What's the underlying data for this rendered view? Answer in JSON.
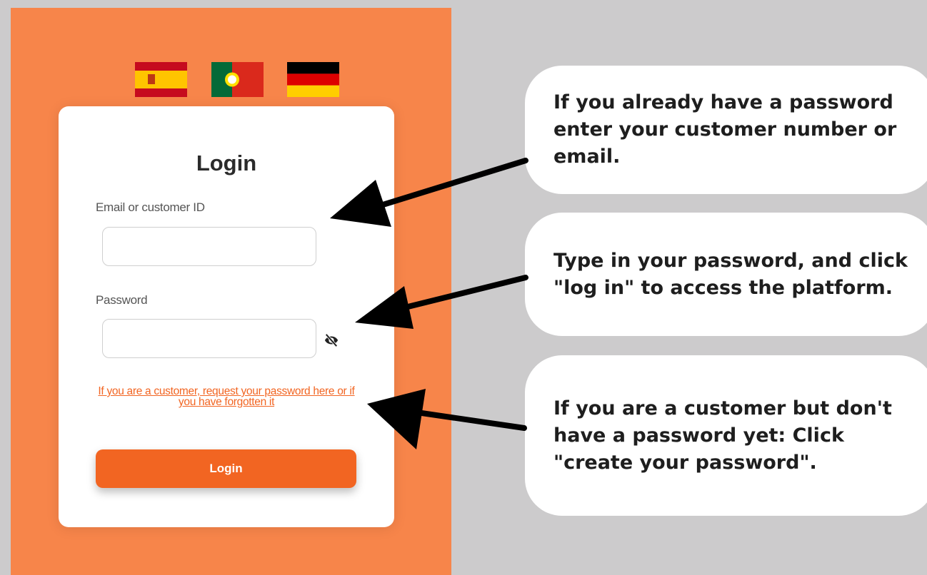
{
  "login": {
    "title": "Login",
    "email_label": "Email or customer ID",
    "email_value": "",
    "password_label": "Password",
    "password_value": "",
    "forgot_link": "If you are a customer, request your password here or if you have forgotten it",
    "login_button": "Login"
  },
  "flags": [
    {
      "name": "spain-flag"
    },
    {
      "name": "portugal-flag"
    },
    {
      "name": "germany-flag"
    }
  ],
  "callouts": [
    "If you already have a password enter your customer number or email.",
    "Type in your password, and click \"log in\" to access the platform.",
    "If you are a customer but don't have a password yet: Click \"create your password\"."
  ],
  "icons": {
    "password_toggle": "eye-slash-icon"
  },
  "colors": {
    "background": "#cccbcc",
    "panel": "#f7854a",
    "accent": "#f26522"
  }
}
